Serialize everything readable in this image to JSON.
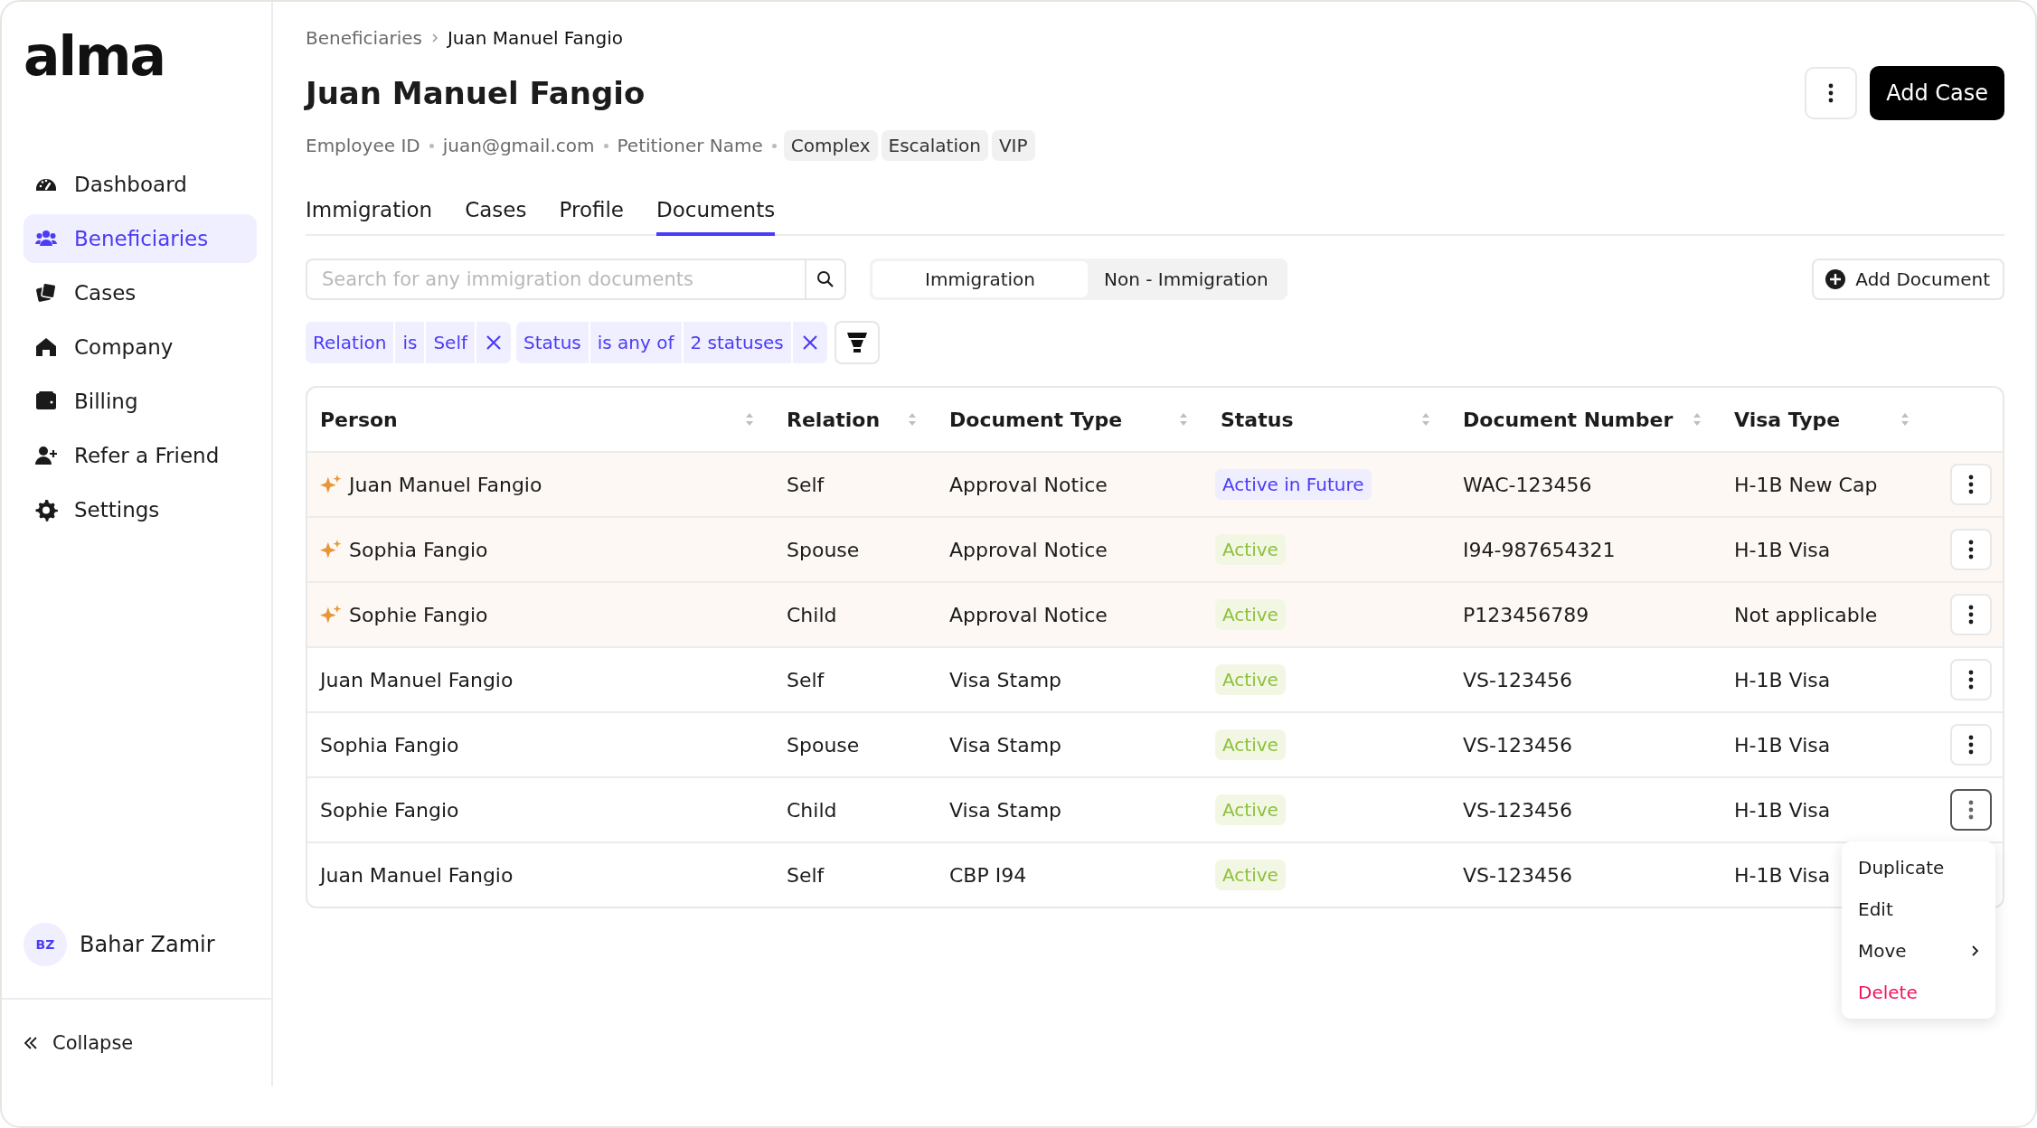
{
  "sidebar": {
    "logo": "alma",
    "items": [
      {
        "label": "Dashboard",
        "selected": false
      },
      {
        "label": "Beneficiaries",
        "selected": true
      },
      {
        "label": "Cases",
        "selected": false
      },
      {
        "label": "Company",
        "selected": false
      },
      {
        "label": "Billing",
        "selected": false
      },
      {
        "label": "Refer a Friend",
        "selected": false
      },
      {
        "label": "Settings",
        "selected": false
      }
    ],
    "user": {
      "initials": "BZ",
      "name": "Bahar Zamir"
    },
    "collapse": "Collapse"
  },
  "breadcrumb": [
    "Beneficiaries",
    "Juan Manuel Fangio"
  ],
  "title": "Juan Manuel Fangio",
  "primary_button": "Add Case",
  "meta": [
    "Employee ID",
    "juan@gmail.com",
    "Petitioner Name"
  ],
  "tags": [
    "Complex",
    "Escalation",
    "VIP"
  ],
  "tabs": [
    {
      "label": "Immigration",
      "selected": false
    },
    {
      "label": "Cases",
      "selected": false
    },
    {
      "label": "Profile",
      "selected": false
    },
    {
      "label": "Documents",
      "selected": true
    }
  ],
  "search": {
    "placeholder": "Search for any immigration documents"
  },
  "segments": [
    {
      "label": "Immigration",
      "selected": true
    },
    {
      "label": "Non - Immigration",
      "selected": false
    }
  ],
  "add_document": "Add Document",
  "filters": [
    {
      "field": "Relation",
      "operator": "is",
      "value": "Self"
    },
    {
      "field": "Status",
      "operator": "is any of",
      "value": "2 statuses"
    }
  ],
  "table": {
    "columns": [
      "Person",
      "Relation",
      "Document Type",
      "Status",
      "Document Number",
      "Visa Type"
    ],
    "rows": [
      {
        "highlighted": true,
        "menu_open": false,
        "cells": [
          "Juan Manuel Fangio",
          "Self",
          "Approval Notice",
          {
            "label": "Active in Future",
            "kind": "future"
          },
          "WAC-123456",
          "H-1B New Cap"
        ]
      },
      {
        "highlighted": true,
        "menu_open": false,
        "cells": [
          "Sophia Fangio",
          "Spouse",
          "Approval Notice",
          {
            "label": "Active",
            "kind": "active"
          },
          "I94-987654321",
          "H-1B Visa"
        ]
      },
      {
        "highlighted": true,
        "menu_open": false,
        "cells": [
          "Sophie Fangio",
          "Child",
          "Approval Notice",
          {
            "label": "Active",
            "kind": "active"
          },
          "P123456789",
          "Not applicable"
        ]
      },
      {
        "highlighted": false,
        "menu_open": false,
        "cells": [
          "Juan Manuel Fangio",
          "Self",
          "Visa Stamp",
          {
            "label": "Active",
            "kind": "active"
          },
          "VS-123456",
          "H-1B Visa"
        ]
      },
      {
        "highlighted": false,
        "menu_open": false,
        "cells": [
          "Sophia Fangio",
          "Spouse",
          "Visa Stamp",
          {
            "label": "Active",
            "kind": "active"
          },
          "VS-123456",
          "H-1B Visa"
        ]
      },
      {
        "highlighted": false,
        "menu_open": true,
        "cells": [
          "Sophie Fangio",
          "Child",
          "Visa Stamp",
          {
            "label": "Active",
            "kind": "active"
          },
          "VS-123456",
          "H-1B Visa"
        ]
      },
      {
        "highlighted": false,
        "menu_open": false,
        "cells": [
          "Juan Manuel Fangio",
          "Self",
          "CBP I94",
          {
            "label": "Active",
            "kind": "active"
          },
          "VS-123456",
          "H-1B Visa"
        ]
      }
    ]
  },
  "row_menu": [
    {
      "label": "Duplicate",
      "kind": "plain"
    },
    {
      "label": "Edit",
      "kind": "plain"
    },
    {
      "label": "Move",
      "kind": "submenu"
    },
    {
      "label": "Delete",
      "kind": "danger"
    }
  ]
}
